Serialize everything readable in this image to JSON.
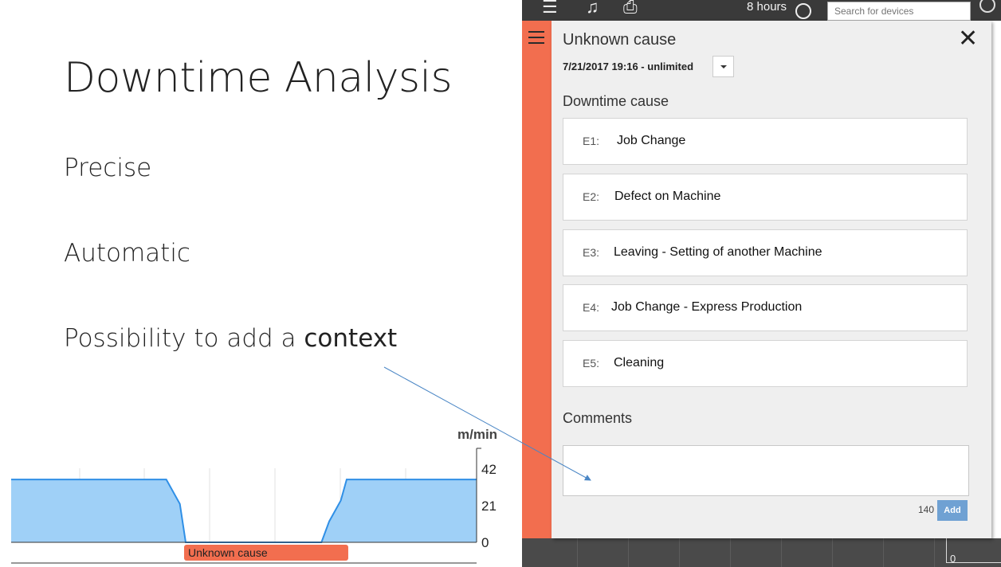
{
  "slide": {
    "title": "Downtime Analysis",
    "bullets": [
      "Precise",
      "Automatic"
    ],
    "bullet3_prefix": "Possibility to add a ",
    "bullet3_emphasis": "context"
  },
  "app_header": {
    "time_range": "8 hours",
    "search_placeholder": "Search for devices",
    "icons": [
      "menu-icon",
      "bell-icon",
      "printer-icon",
      "clock-icon",
      "search-icon"
    ]
  },
  "dialog": {
    "title": "Unknown cause",
    "date_range": "7/21/2017 19:16 - unlimited",
    "section_cause": "Downtime cause",
    "causes": [
      {
        "code": "E1:",
        "label": "Job Change"
      },
      {
        "code": "E2:",
        "label": "Defect on Machine"
      },
      {
        "code": "E3:",
        "label": "Leaving - Setting of another Machine"
      },
      {
        "code": "E4:",
        "label": "Job Change - Express Production"
      },
      {
        "code": "E5:",
        "label": "Cleaning"
      }
    ],
    "section_comments": "Comments",
    "char_counter": "140",
    "add_label": "Add",
    "accent_color": "#f26e4f",
    "button_color": "#6fa1d3"
  },
  "bottom_axis_zero": "0",
  "chart_data": {
    "type": "area",
    "unit_label": "m/min",
    "y_ticks": [
      "42",
      "21",
      "0"
    ],
    "ylim": [
      0,
      42
    ],
    "x": [
      0,
      1,
      2,
      3,
      4,
      4.35,
      4.5,
      8,
      8.2,
      8.5,
      8.65,
      9,
      12
    ],
    "values": [
      36,
      36,
      36,
      36,
      36,
      22,
      0,
      0,
      12,
      24,
      36,
      36,
      36
    ],
    "xlim": [
      0,
      12
    ],
    "event_label": "Unknown cause",
    "event_range": [
      4.5,
      8.65
    ],
    "fill_color": "#9fd0f7",
    "line_color": "#2f8fe6",
    "event_color": "#f26e4f"
  }
}
